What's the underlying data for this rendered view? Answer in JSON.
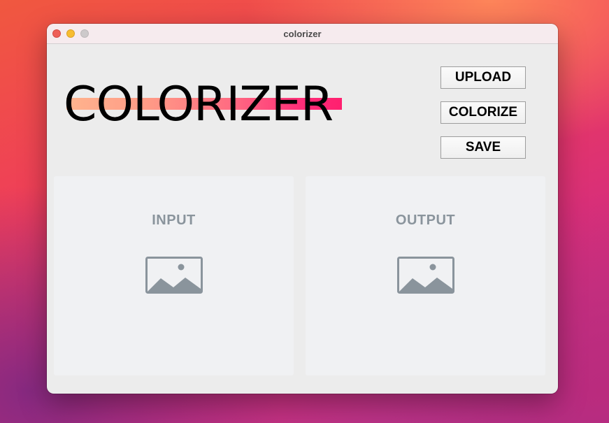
{
  "window": {
    "title": "colorizer"
  },
  "logo": {
    "text": "COLORIZER"
  },
  "toolbar": {
    "upload_label": "UPLOAD",
    "colorize_label": "COLORIZE",
    "save_label": "SAVE"
  },
  "panels": {
    "input": {
      "label": "INPUT",
      "icon": "image-placeholder-icon"
    },
    "output": {
      "label": "OUTPUT",
      "icon": "image-placeholder-icon"
    }
  },
  "colors": {
    "logo_stripe_start": "#ffb48e",
    "logo_stripe_end": "#ff1f6f",
    "panel_text": "#8a949c",
    "panel_background": "#f0f1f3",
    "window_background": "#ececec"
  }
}
